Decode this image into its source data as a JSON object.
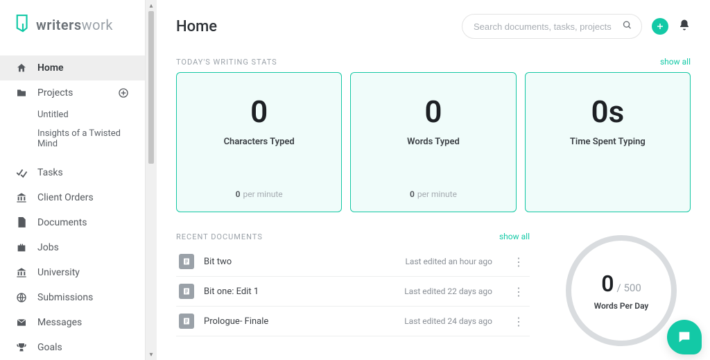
{
  "brand": {
    "strong": "writers",
    "light": "work"
  },
  "header": {
    "title": "Home",
    "search_placeholder": "Search documents, tasks, projects"
  },
  "sidebar": {
    "items": [
      {
        "key": "home",
        "label": "Home",
        "icon": "home",
        "active": true
      },
      {
        "key": "projects",
        "label": "Projects",
        "icon": "folder",
        "add": true,
        "children": [
          {
            "key": "untitled",
            "label": "Untitled"
          },
          {
            "key": "insights",
            "label": "Insights of a Twisted Mind"
          }
        ]
      },
      {
        "key": "tasks",
        "label": "Tasks",
        "icon": "check"
      },
      {
        "key": "client-orders",
        "label": "Client Orders",
        "icon": "bank"
      },
      {
        "key": "documents",
        "label": "Documents",
        "icon": "doc"
      },
      {
        "key": "jobs",
        "label": "Jobs",
        "icon": "briefcase"
      },
      {
        "key": "university",
        "label": "University",
        "icon": "bank"
      },
      {
        "key": "submissions",
        "label": "Submissions",
        "icon": "globe"
      },
      {
        "key": "messages",
        "label": "Messages",
        "icon": "mail"
      },
      {
        "key": "goals",
        "label": "Goals",
        "icon": "trophy"
      }
    ]
  },
  "stats": {
    "heading": "TODAY'S WRITING STATS",
    "show_all": "show all",
    "cards": [
      {
        "value": "0",
        "label": "Characters Typed",
        "foot_num": "0",
        "foot_txt": "per minute"
      },
      {
        "value": "0",
        "label": "Words Typed",
        "foot_num": "0",
        "foot_txt": "per minute"
      },
      {
        "value": "0s",
        "label": "Time Spent Typing"
      }
    ]
  },
  "recent": {
    "heading": "RECENT DOCUMENTS",
    "show_all": "show all",
    "rows": [
      {
        "title": "Bit two",
        "time": "Last edited an hour ago"
      },
      {
        "title": "Bit one: Edit 1",
        "time": "Last edited 22 days ago"
      },
      {
        "title": "Prologue- Finale",
        "time": "Last edited 24 days ago"
      }
    ]
  },
  "goal_ring": {
    "value": "0",
    "sep": "/",
    "target": "500",
    "label": "Words Per Day"
  },
  "colors": {
    "accent": "#13c9a6"
  }
}
